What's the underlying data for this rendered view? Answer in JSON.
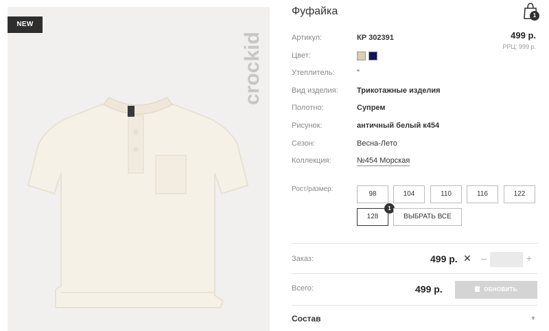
{
  "product": {
    "badge": "NEW",
    "brand_watermark": "crockid",
    "title": "Фуфайка",
    "price": "499 р.",
    "rrp": "РРЦ: 999 р."
  },
  "cart": {
    "icon": "shopping-bag-icon",
    "count": "1"
  },
  "attributes": [
    {
      "label": "Артикул:",
      "value": "КР 302391"
    },
    {
      "label": "Цвет:",
      "swatches": [
        "#d9cdb4",
        "#12125e"
      ]
    },
    {
      "label": "Утеплитель:",
      "value": "\""
    },
    {
      "label": "Вид изделия:",
      "value": "Трикотажные изделия"
    },
    {
      "label": "Полотно:",
      "value": "Супрем"
    },
    {
      "label": "Рисунок:",
      "value": "античный белый к454"
    },
    {
      "label": "Сезон:",
      "value": "Весна-Лето"
    },
    {
      "label": "Коллекция:",
      "value": "№454 Морская"
    }
  ],
  "sizes": {
    "label": "Рост/размер:",
    "options": [
      "98",
      "104",
      "110",
      "116",
      "122",
      "128"
    ],
    "selected": "128",
    "selected_count": "1",
    "select_all": "ВЫБРАТЬ ВСЕ"
  },
  "order": {
    "label": "Заказ:",
    "price": "499 р.",
    "remove": "✕",
    "minus": "–",
    "quantity": "",
    "plus": "+"
  },
  "total": {
    "label": "Всего:",
    "price": "499 р.",
    "update": "ОБНОВИТЬ"
  },
  "composition": {
    "title": "Состав",
    "caret": "▼"
  }
}
